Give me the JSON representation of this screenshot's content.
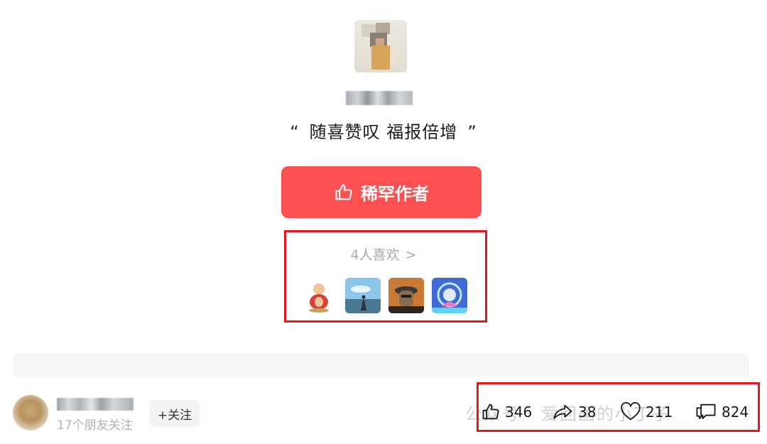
{
  "author": {
    "quote": "随喜赞叹 福报倍增",
    "quote_open": "“",
    "quote_close": "”"
  },
  "reward_button": {
    "label": "稀罕作者",
    "icon": "thumbs-up-icon",
    "color": "#fb5151"
  },
  "likers": {
    "count_label": "4人喜欢",
    "chevron": ">",
    "avatars": [
      "buddha-figure",
      "sky-scene",
      "person-hat",
      "lotus-light"
    ]
  },
  "follower": {
    "friends_follow": "17个朋友关注",
    "follow_button": "+关注"
  },
  "stats": {
    "likes": "346",
    "shares": "38",
    "favorites": "211",
    "comments": "824"
  },
  "watermark": "公众号 · 爱回画的小丁子",
  "accent_colors": {
    "highlight": "#e8171c"
  }
}
